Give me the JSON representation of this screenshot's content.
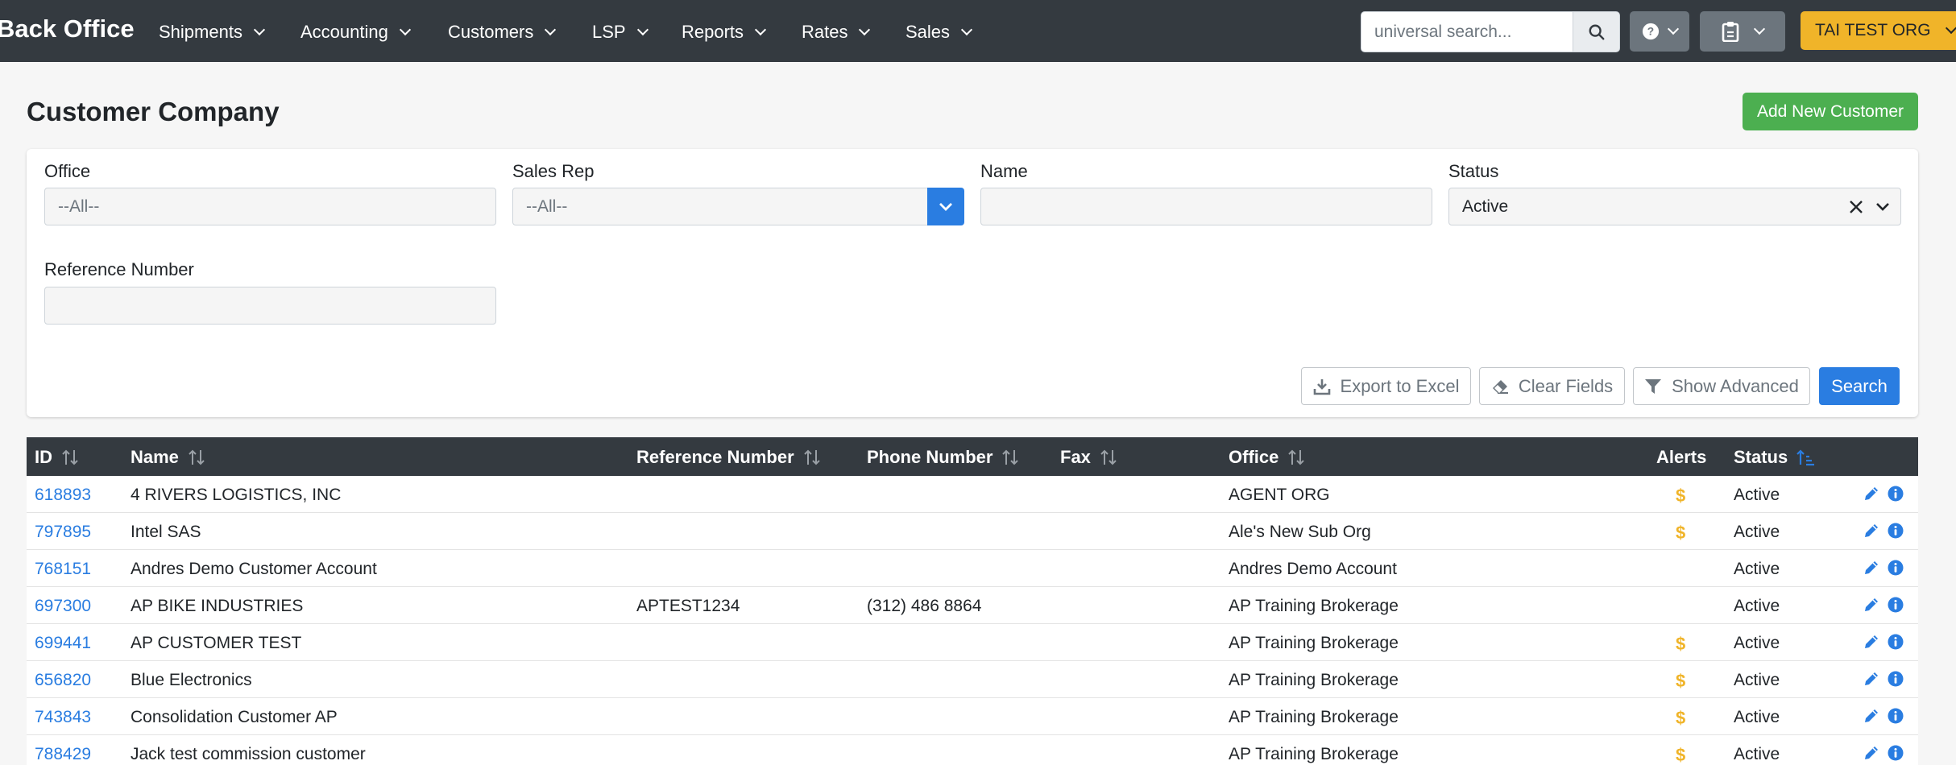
{
  "navbar": {
    "brand": "Back Office",
    "items": [
      "Shipments",
      "Accounting",
      "Customers",
      "LSP",
      "Reports",
      "Rates",
      "Sales"
    ],
    "search_placeholder": "universal search...",
    "org": "TAI TEST ORG"
  },
  "header": {
    "title": "Customer Company",
    "add_label": "Add New Customer"
  },
  "filters": {
    "office_label": "Office",
    "office_value": "--All--",
    "salesrep_label": "Sales Rep",
    "salesrep_value": "--All--",
    "name_label": "Name",
    "name_value": "",
    "status_label": "Status",
    "status_value": "Active",
    "ref_label": "Reference Number",
    "ref_value": ""
  },
  "actions": {
    "export": "Export to Excel",
    "clear": "Clear Fields",
    "advanced": "Show Advanced",
    "search": "Search"
  },
  "table": {
    "headers": [
      "ID",
      "Name",
      "Reference Number",
      "Phone Number",
      "Fax",
      "Office",
      "Alerts",
      "Status"
    ],
    "rows": [
      {
        "id": "618893",
        "name": "4 RIVERS LOGISTICS, INC",
        "ref": "",
        "phone": "",
        "fax": "",
        "office": "AGENT ORG",
        "alert": "$",
        "status": "Active"
      },
      {
        "id": "797895",
        "name": "Intel SAS",
        "ref": "",
        "phone": "",
        "fax": "",
        "office": "Ale's New Sub Org",
        "alert": "$",
        "status": "Active"
      },
      {
        "id": "768151",
        "name": "Andres Demo Customer Account",
        "ref": "",
        "phone": "",
        "fax": "",
        "office": "Andres Demo Account",
        "alert": "",
        "status": "Active"
      },
      {
        "id": "697300",
        "name": "AP BIKE INDUSTRIES",
        "ref": "APTEST1234",
        "phone": "(312) 486 8864",
        "fax": "",
        "office": "AP Training Brokerage",
        "alert": "",
        "status": "Active"
      },
      {
        "id": "699441",
        "name": "AP CUSTOMER TEST",
        "ref": "",
        "phone": "",
        "fax": "",
        "office": "AP Training Brokerage",
        "alert": "$",
        "status": "Active"
      },
      {
        "id": "656820",
        "name": "Blue Electronics",
        "ref": "",
        "phone": "",
        "fax": "",
        "office": "AP Training Brokerage",
        "alert": "$",
        "status": "Active"
      },
      {
        "id": "743843",
        "name": "Consolidation Customer AP",
        "ref": "",
        "phone": "",
        "fax": "",
        "office": "AP Training Brokerage",
        "alert": "$",
        "status": "Active"
      },
      {
        "id": "788429",
        "name": "Jack test commission customer",
        "ref": "",
        "phone": "",
        "fax": "",
        "office": "AP Training Brokerage",
        "alert": "$",
        "status": "Active"
      }
    ]
  }
}
